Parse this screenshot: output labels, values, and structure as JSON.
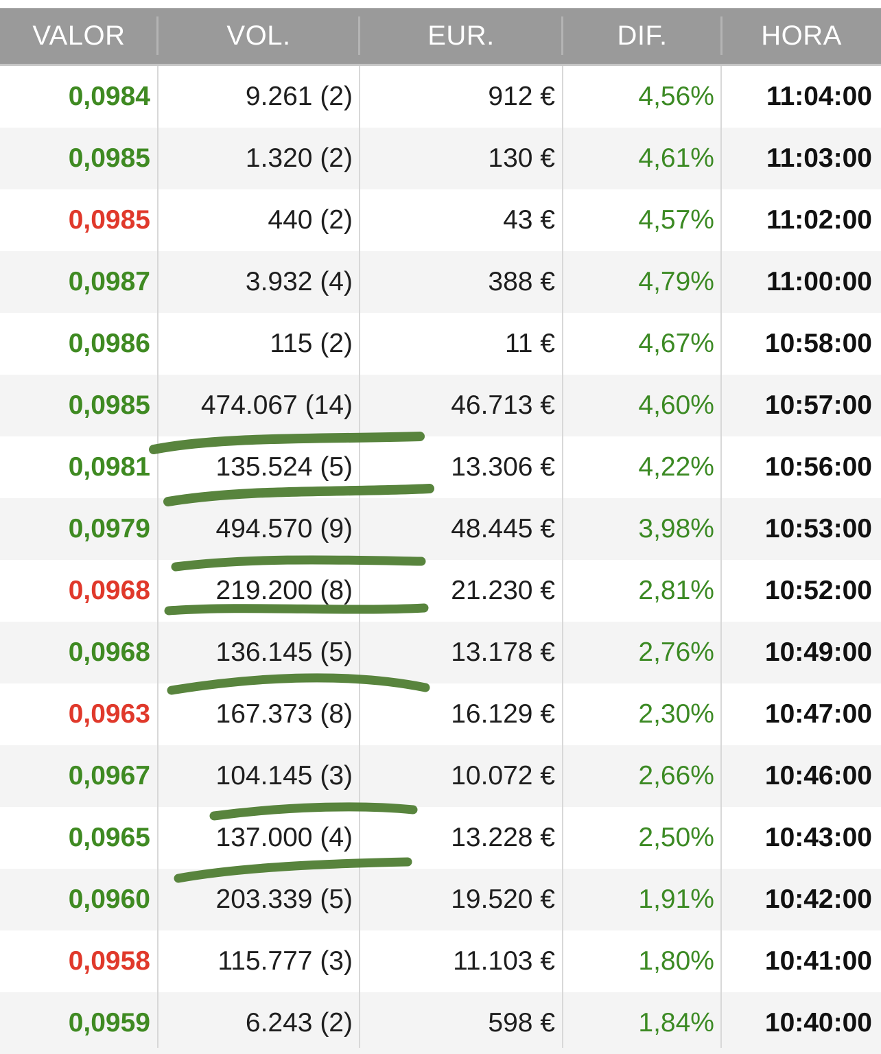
{
  "headers": {
    "valor": "VALOR",
    "vol": "VOL.",
    "eur": "EUR.",
    "dif": "DIF.",
    "hora": "HORA"
  },
  "colors": {
    "up": "#3f8a22",
    "down": "#e0392b",
    "dif": "#3c8a24",
    "header_bg": "#9a9a9a",
    "scribble": "#4a7a2c"
  },
  "rows": [
    {
      "valor": "0,0984",
      "dir": "up",
      "vol": "9.261 (2)",
      "eur": "912 €",
      "dif": "4,56%",
      "hora": "11:04:00"
    },
    {
      "valor": "0,0985",
      "dir": "up",
      "vol": "1.320 (2)",
      "eur": "130 €",
      "dif": "4,61%",
      "hora": "11:03:00"
    },
    {
      "valor": "0,0985",
      "dir": "down",
      "vol": "440 (2)",
      "eur": "43 €",
      "dif": "4,57%",
      "hora": "11:02:00"
    },
    {
      "valor": "0,0987",
      "dir": "up",
      "vol": "3.932 (4)",
      "eur": "388 €",
      "dif": "4,79%",
      "hora": "11:00:00"
    },
    {
      "valor": "0,0986",
      "dir": "up",
      "vol": "115 (2)",
      "eur": "11 €",
      "dif": "4,67%",
      "hora": "10:58:00"
    },
    {
      "valor": "0,0985",
      "dir": "up",
      "vol": "474.067 (14)",
      "eur": "46.713 €",
      "dif": "4,60%",
      "hora": "10:57:00"
    },
    {
      "valor": "0,0981",
      "dir": "up",
      "vol": "135.524 (5)",
      "eur": "13.306 €",
      "dif": "4,22%",
      "hora": "10:56:00"
    },
    {
      "valor": "0,0979",
      "dir": "up",
      "vol": "494.570 (9)",
      "eur": "48.445 €",
      "dif": "3,98%",
      "hora": "10:53:00"
    },
    {
      "valor": "0,0968",
      "dir": "down",
      "vol": "219.200 (8)",
      "eur": "21.230 €",
      "dif": "2,81%",
      "hora": "10:52:00"
    },
    {
      "valor": "0,0968",
      "dir": "up",
      "vol": "136.145 (5)",
      "eur": "13.178 €",
      "dif": "2,76%",
      "hora": "10:49:00"
    },
    {
      "valor": "0,0963",
      "dir": "down",
      "vol": "167.373 (8)",
      "eur": "16.129 €",
      "dif": "2,30%",
      "hora": "10:47:00"
    },
    {
      "valor": "0,0967",
      "dir": "up",
      "vol": "104.145 (3)",
      "eur": "10.072 €",
      "dif": "2,66%",
      "hora": "10:46:00"
    },
    {
      "valor": "0,0965",
      "dir": "up",
      "vol": "137.000 (4)",
      "eur": "13.228 €",
      "dif": "2,50%",
      "hora": "10:43:00"
    },
    {
      "valor": "0,0960",
      "dir": "up",
      "vol": "203.339 (5)",
      "eur": "19.520 €",
      "dif": "1,91%",
      "hora": "10:42:00"
    },
    {
      "valor": "0,0958",
      "dir": "down",
      "vol": "115.777 (3)",
      "eur": "11.103 €",
      "dif": "1,80%",
      "hora": "10:41:00"
    },
    {
      "valor": "0,0959",
      "dir": "up",
      "vol": "6.243 (2)",
      "eur": "598 €",
      "dif": "1,84%",
      "hora": "10:40:00"
    }
  ]
}
